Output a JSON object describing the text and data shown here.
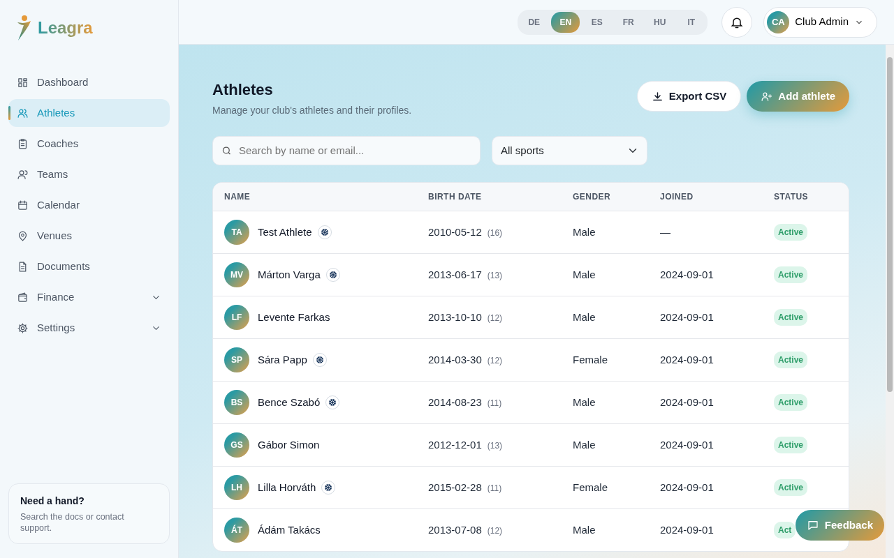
{
  "brand": {
    "name": "Leagra"
  },
  "sidebar": {
    "items": [
      {
        "label": "Dashboard",
        "selected": false
      },
      {
        "label": "Athletes",
        "selected": true
      },
      {
        "label": "Coaches",
        "selected": false
      },
      {
        "label": "Teams",
        "selected": false
      },
      {
        "label": "Calendar",
        "selected": false
      },
      {
        "label": "Venues",
        "selected": false
      },
      {
        "label": "Documents",
        "selected": false
      },
      {
        "label": "Finance",
        "selected": false,
        "expandable": true
      },
      {
        "label": "Settings",
        "selected": false,
        "expandable": true
      }
    ],
    "help": {
      "title": "Need a hand?",
      "text": "Search the docs or contact support."
    }
  },
  "header": {
    "languages": [
      {
        "code": "DE",
        "selected": false
      },
      {
        "code": "EN",
        "selected": true
      },
      {
        "code": "ES",
        "selected": false
      },
      {
        "code": "FR",
        "selected": false
      },
      {
        "code": "HU",
        "selected": false
      },
      {
        "code": "IT",
        "selected": false
      }
    ],
    "user": {
      "initials": "CA",
      "name": "Club Admin"
    }
  },
  "page": {
    "title": "Athletes",
    "subtitle": "Manage your club's athletes and their profiles.",
    "buttons": [
      {
        "kind": "secondary",
        "label": "Export CSV"
      },
      {
        "kind": "primary",
        "label": "Add athlete"
      }
    ]
  },
  "filters": {
    "search": {
      "placeholder": "Search by name or email..."
    },
    "sport": {
      "value": "All sports"
    }
  },
  "table": {
    "columns": [
      "NAME",
      "BIRTH DATE",
      "GENDER",
      "JOINED",
      "STATUS"
    ],
    "rows": [
      {
        "initials": "TA",
        "name": "Test Athlete",
        "emblem": true,
        "birth_date": "2010-05-12",
        "age": "(16)",
        "gender": "Male",
        "joined": "—",
        "status": "Active"
      },
      {
        "initials": "MV",
        "name": "Márton Varga",
        "emblem": true,
        "birth_date": "2013-06-17",
        "age": "(13)",
        "gender": "Male",
        "joined": "2024-09-01",
        "status": "Active"
      },
      {
        "initials": "LF",
        "name": "Levente Farkas",
        "emblem": false,
        "birth_date": "2013-10-10",
        "age": "(12)",
        "gender": "Male",
        "joined": "2024-09-01",
        "status": "Active"
      },
      {
        "initials": "SP",
        "name": "Sára Papp",
        "emblem": true,
        "birth_date": "2014-03-30",
        "age": "(12)",
        "gender": "Female",
        "joined": "2024-09-01",
        "status": "Active"
      },
      {
        "initials": "BS",
        "name": "Bence Szabó",
        "emblem": true,
        "birth_date": "2014-08-23",
        "age": "(11)",
        "gender": "Male",
        "joined": "2024-09-01",
        "status": "Active"
      },
      {
        "initials": "GS",
        "name": "Gábor Simon",
        "emblem": false,
        "birth_date": "2012-12-01",
        "age": "(13)",
        "gender": "Male",
        "joined": "2024-09-01",
        "status": "Active"
      },
      {
        "initials": "LH",
        "name": "Lilla Horváth",
        "emblem": true,
        "birth_date": "2015-02-28",
        "age": "(11)",
        "gender": "Female",
        "joined": "2024-09-01",
        "status": "Active"
      },
      {
        "initials": "ÁT",
        "name": "Ádám Takács",
        "emblem": false,
        "birth_date": "2013-07-08",
        "age": "(12)",
        "gender": "Male",
        "joined": "2024-09-01",
        "status": "Act"
      }
    ]
  },
  "feedback": {
    "label": "Feedback"
  }
}
